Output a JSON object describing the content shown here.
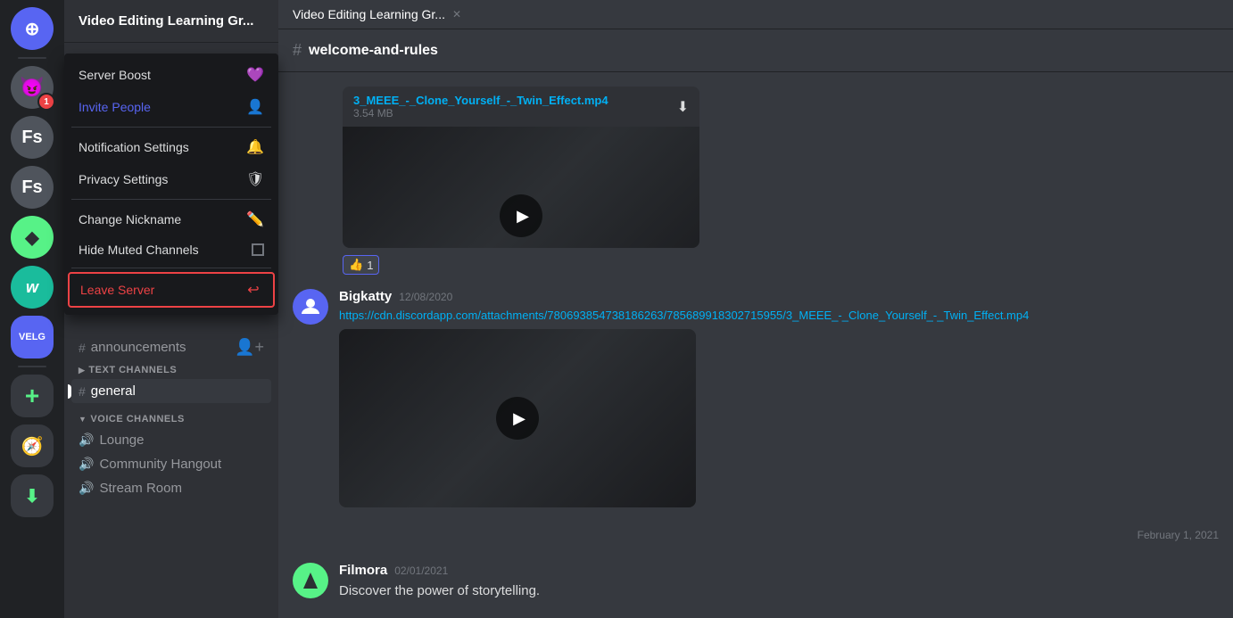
{
  "app": {
    "title": "Video Editing Learning Gr...",
    "tab_close": "✕"
  },
  "server_list": {
    "icons": [
      {
        "id": "discord-home",
        "label": "Discord",
        "symbol": "⊕",
        "class": "discord-home"
      },
      {
        "id": "emoji-server",
        "label": "Emoji Server",
        "symbol": "😈",
        "class": "notification-badge"
      },
      {
        "id": "fs-1",
        "label": "Fs Server 1",
        "symbol": "Fs",
        "class": "fs-1"
      },
      {
        "id": "fs-2",
        "label": "Fs Server 2",
        "symbol": "Fs",
        "class": "fs-2"
      },
      {
        "id": "green-server",
        "label": "Green Server",
        "symbol": "◆",
        "class": "green-icon"
      },
      {
        "id": "teal-w",
        "label": "W Server",
        "symbol": "w",
        "class": "teal-w"
      },
      {
        "id": "velg",
        "label": "VELG",
        "symbol": "VELG",
        "class": "velg"
      },
      {
        "id": "add-server",
        "label": "Add Server",
        "symbol": "+",
        "class": "add-server"
      },
      {
        "id": "explore",
        "label": "Explore",
        "symbol": "🧭",
        "class": "compass"
      },
      {
        "id": "download",
        "label": "Download",
        "symbol": "⬇",
        "class": "download"
      }
    ]
  },
  "context_menu": {
    "items": [
      {
        "id": "server-boost",
        "label": "Server Boost",
        "icon": "💜",
        "class": "pink"
      },
      {
        "id": "invite-people",
        "label": "Invite People",
        "icon": "👤+",
        "class": "blue",
        "highlighted": true
      },
      {
        "id": "notification-settings",
        "label": "Notification Settings",
        "icon": "🔔"
      },
      {
        "id": "privacy-settings",
        "label": "Privacy Settings",
        "icon": "🛡"
      },
      {
        "id": "change-nickname",
        "label": "Change Nickname",
        "icon": "✏️"
      },
      {
        "id": "hide-muted-channels",
        "label": "Hide Muted Channels",
        "icon": "☐"
      },
      {
        "id": "leave-server",
        "label": "Leave Server",
        "icon": "🚪",
        "danger": true
      }
    ]
  },
  "channel_sidebar": {
    "server_name": "Video Editing Learning Gr...",
    "announcements": "announcements",
    "text_channels": {
      "header": "TEXT CHANNELS",
      "channels": [
        {
          "id": "general",
          "name": "general",
          "active": true
        }
      ]
    },
    "voice_channels": {
      "header": "VOICE CHANNELS",
      "channels": [
        {
          "id": "lounge",
          "name": "Lounge"
        },
        {
          "id": "community-hangout",
          "name": "Community Hangout"
        },
        {
          "id": "stream-room",
          "name": "Stream Room"
        }
      ]
    }
  },
  "channel_header": {
    "icon": "#",
    "name": "welcome-and-rules"
  },
  "messages": [
    {
      "id": "msg-video-1",
      "filename": "3_MEEE_-_Clone_Yourself_-_Twin_Effect.mp4",
      "filesize": "3.54 MB",
      "reaction_emoji": "👍",
      "reaction_count": "1"
    },
    {
      "id": "msg-bigkatty",
      "author": "Bigkatty",
      "timestamp": "12/08/2020",
      "link": "https://cdn.discordapp.com/attachments/780693854738186263/785689918302715955/3_MEEE_-_Clone_Yourself_-_Twin_Effect.mp4",
      "avatar_symbol": "🎮"
    },
    {
      "id": "msg-filmora",
      "author": "Filmora",
      "timestamp": "02/01/2021",
      "text": "Discover the power of storytelling.",
      "avatar_symbol": "◆"
    }
  ],
  "date_divider": "February 1, 2021"
}
